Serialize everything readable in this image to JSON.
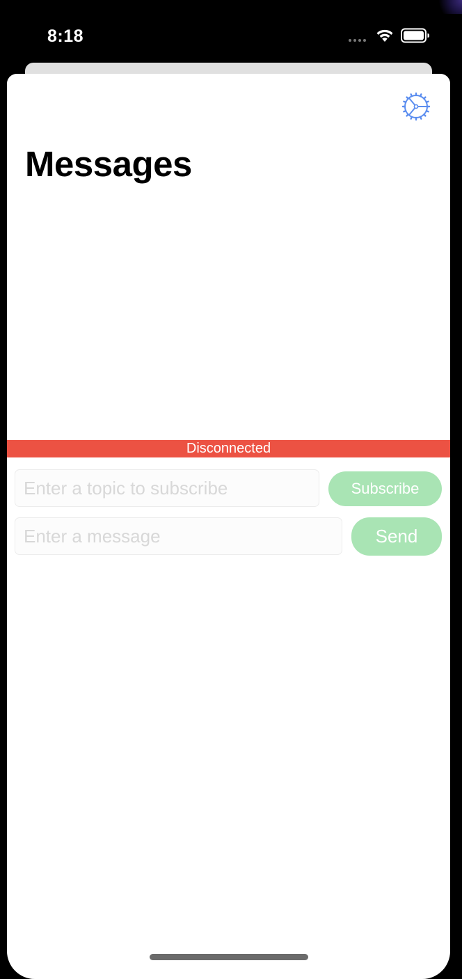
{
  "status_bar": {
    "time": "8:18",
    "icons": [
      "cellular-dots-icon",
      "wifi-icon",
      "battery-icon"
    ]
  },
  "header": {
    "settings_icon": "gear-icon",
    "title": "Messages"
  },
  "connection": {
    "status_text": "Disconnected",
    "status_color": "#ec5243"
  },
  "subscribe": {
    "placeholder": "Enter a topic to subscribe",
    "value": "",
    "button_label": "Subscribe"
  },
  "publish": {
    "placeholder": "Enter a message",
    "value": "",
    "button_label": "Send"
  },
  "colors": {
    "accent": "#5b8def",
    "button_disabled": "#a9e4b4",
    "danger": "#ec5243"
  }
}
